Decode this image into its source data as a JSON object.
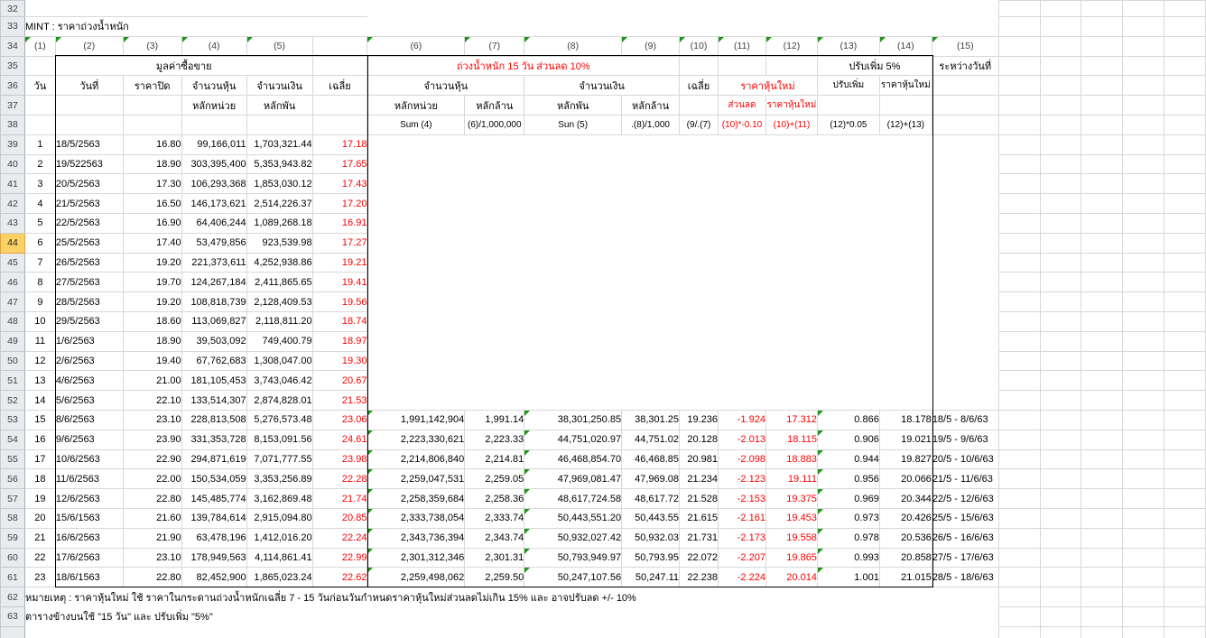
{
  "sheet": {
    "title": "MINT : ราคาถ่วงน้ำหนัก",
    "row_numbers": [
      32,
      33,
      34,
      35,
      36,
      37,
      38,
      39,
      40,
      41,
      42,
      43,
      44,
      45,
      46,
      47,
      48,
      49,
      50,
      51,
      52,
      53,
      54,
      55,
      56,
      57,
      58,
      59,
      60,
      61,
      62,
      63
    ],
    "selected_row_header": 44,
    "column_labels": [
      "(1)",
      "(2)",
      "(3)",
      "(4)",
      "(5)",
      "(6)",
      "(7)",
      "(8)",
      "(9)",
      "(10)",
      "(11)",
      "(12)",
      "(13)",
      "(14)",
      "(15)"
    ],
    "header": {
      "group_trading_value": "มูลค่าซื้อขาย",
      "group_weighted": "ถ่วงน้ำหนัก   15 วัน   ส่วนลด   10%",
      "group_increase": "ปรับเพิ่ม   5%",
      "between_dates": "ระหว่างวันที่",
      "col_day": "วัน",
      "col_date": "วันที่",
      "col_close": "ราคาปิด",
      "col_shares": "จำนวนหุ้น",
      "col_amount": "จำนวนเงิน",
      "col_avg": "เฉลี่ย",
      "col_new_price_group": "ราคาหุ้นใหม่",
      "col_adjust_up": "ปรับเพิ่ม",
      "col_new_price": "ราคาหุ้นใหม่",
      "sub_units": "หลักหน่วย",
      "sub_thousand": "หลักพัน",
      "sub_million": "หลักล้าน",
      "sub_discount": "ส่วนลด",
      "sub_new_price": "ราคาหุ้นใหม่",
      "formulas": [
        "Sum (4)",
        "(6)/1,000,000",
        "Sun (5)",
        ".(8)/1,000",
        "(9/.(7)",
        "(10)*-0.10",
        "(10)+(11)",
        "(12)*0.05",
        "(12)+(13)"
      ]
    },
    "rows": [
      [
        "1",
        "18/5/2563",
        "16.80",
        "99,166,011",
        "1,703,321.44",
        "17.18",
        "",
        "",
        "",
        "",
        "",
        "",
        "",
        "",
        "",
        ""
      ],
      [
        "2",
        "19/522563",
        "18.90",
        "303,395,400",
        "5,353,943.82",
        "17.65",
        "",
        "",
        "",
        "",
        "",
        "",
        "",
        "",
        "",
        ""
      ],
      [
        "3",
        "20/5/2563",
        "17.30",
        "106,293,368",
        "1,853,030.12",
        "17.43",
        "",
        "",
        "",
        "",
        "",
        "",
        "",
        "",
        "",
        ""
      ],
      [
        "4",
        "21/5/2563",
        "16.50",
        "146,173,621",
        "2,514,226.37",
        "17.20",
        "",
        "",
        "",
        "",
        "",
        "",
        "",
        "",
        "",
        ""
      ],
      [
        "5",
        "22/5/2563",
        "16.90",
        "64,406,244",
        "1,089,268.18",
        "16.91",
        "",
        "",
        "",
        "",
        "",
        "",
        "",
        "",
        "",
        ""
      ],
      [
        "6",
        "25/5/2563",
        "17.40",
        "53,479,856",
        "923,539.98",
        "17.27",
        "",
        "",
        "",
        "",
        "",
        "",
        "",
        "",
        "",
        ""
      ],
      [
        "7",
        "26/5/2563",
        "19.20",
        "221,373,611",
        "4,252,938.86",
        "19.21",
        "",
        "",
        "",
        "",
        "",
        "",
        "",
        "",
        "",
        ""
      ],
      [
        "8",
        "27/5/2563",
        "19.70",
        "124,267,184",
        "2,411,865.65",
        "19.41",
        "",
        "",
        "",
        "",
        "",
        "",
        "",
        "",
        "",
        ""
      ],
      [
        "9",
        "28/5/2563",
        "19.20",
        "108,818,739",
        "2,128,409.53",
        "19.56",
        "",
        "",
        "",
        "",
        "",
        "",
        "",
        "",
        "",
        ""
      ],
      [
        "10",
        "29/5/2563",
        "18.60",
        "113,069,827",
        "2,118,811.20",
        "18.74",
        "",
        "",
        "",
        "",
        "",
        "",
        "",
        "",
        "",
        ""
      ],
      [
        "11",
        "1/6/2563",
        "18.90",
        "39,503,092",
        "749,400.79",
        "18.97",
        "",
        "",
        "",
        "",
        "",
        "",
        "",
        "",
        "",
        ""
      ],
      [
        "12",
        "2/6/2563",
        "19.40",
        "67,762,683",
        "1,308,047.00",
        "19.30",
        "",
        "",
        "",
        "",
        "",
        "",
        "",
        "",
        "",
        ""
      ],
      [
        "13",
        "4/6/2563",
        "21.00",
        "181,105,453",
        "3,743,046.42",
        "20.67",
        "",
        "",
        "",
        "",
        "",
        "",
        "",
        "",
        "",
        ""
      ],
      [
        "14",
        "5/6/2563",
        "22.10",
        "133,514,307",
        "2,874,828.01",
        "21.53",
        "",
        "",
        "",
        "",
        "",
        "",
        "",
        "",
        "",
        ""
      ],
      [
        "15",
        "8/6/2563",
        "23.10",
        "228,813,508",
        "5,276,573.48",
        "23.06",
        "1,991,142,904",
        "1,991.14",
        "38,301,250.85",
        "38,301.25",
        "19.236",
        "-1.924",
        "17.312",
        "0.866",
        "18.178",
        "18/5 - 8/6/63"
      ],
      [
        "16",
        "9/6/2563",
        "23.90",
        "331,353,728",
        "8,153,091.56",
        "24.61",
        "2,223,330,621",
        "2,223.33",
        "44,751,020.97",
        "44,751.02",
        "20.128",
        "-2.013",
        "18.115",
        "0.906",
        "19.021",
        "19/5 - 9/6/63"
      ],
      [
        "17",
        "10/6/2563",
        "22.90",
        "294,871,619",
        "7,071,777.55",
        "23.98",
        "2,214,806,840",
        "2,214.81",
        "46,468,854.70",
        "46,468.85",
        "20.981",
        "-2.098",
        "18.883",
        "0.944",
        "19.827",
        "20/5 - 10/6/63"
      ],
      [
        "18",
        "11/6/2563",
        "22.00",
        "150,534,059",
        "3,353,256.89",
        "22.28",
        "2,259,047,531",
        "2,259.05",
        "47,969,081.47",
        "47,969.08",
        "21.234",
        "-2.123",
        "19.111",
        "0.956",
        "20.066",
        "21/5 - 11/6/63"
      ],
      [
        "19",
        "12/6/2563",
        "22.80",
        "145,485,774",
        "3,162,869.48",
        "21.74",
        "2,258,359,684",
        "2,258.36",
        "48,617,724.58",
        "48,617.72",
        "21.528",
        "-2.153",
        "19.375",
        "0.969",
        "20.344",
        "22/5 - 12/6/63"
      ],
      [
        "20",
        "15/6/1563",
        "21.60",
        "139,784,614",
        "2,915,094.80",
        "20.85",
        "2,333,738,054",
        "2,333.74",
        "50,443,551.20",
        "50,443.55",
        "21.615",
        "-2.161",
        "19.453",
        "0.973",
        "20.426",
        "25/5 - 15/6/63"
      ],
      [
        "21",
        "16/6/2563",
        "21.90",
        "63,478,196",
        "1,412,016.20",
        "22.24",
        "2,343,736,394",
        "2,343.74",
        "50,932,027.42",
        "50,932.03",
        "21.731",
        "-2.173",
        "19.558",
        "0.978",
        "20.536",
        "26/5 - 16/6/63"
      ],
      [
        "22",
        "17/6/2563",
        "23.10",
        "178,949,563",
        "4,114,861.41",
        "22.99",
        "2,301,312,346",
        "2,301.31",
        "50,793,949.97",
        "50,793.95",
        "22.072",
        "-2.207",
        "19.865",
        "0.993",
        "20.858",
        "27/5 - 17/6/63"
      ],
      [
        "23",
        "18/6/1563",
        "22.80",
        "82,452,900",
        "1,865,023.24",
        "22.62",
        "2,259,498,062",
        "2,259.50",
        "50,247,107.56",
        "50,247.11",
        "22.238",
        "-2.224",
        "20.014",
        "1.001",
        "21.015",
        "28/5 - 18/6/63"
      ]
    ],
    "notes": [
      "หมายเหตุ : ราคาหุ้นใหม่ ใช้ ราคาในกระดานถ่วงน้ำหนักเฉลี่ย 7 - 15 วันก่อนวันกำหนดราคาหุ้นใหม่ส่วนลดไม่เกิน 15% และ อาจปรับลด +/- 10%",
      "ตารางข้างบนใช้ \"15 วัน\" และ ปรับเพิ่ม \"5%\""
    ],
    "colors": {
      "red_text": "#ff0000",
      "flag_green": "#1e9418",
      "gridline": "#d8d8d8",
      "row_header_fill": "#e9ebee",
      "selected_row_header_fill": "#fbd064",
      "border_black": "#000000"
    }
  }
}
